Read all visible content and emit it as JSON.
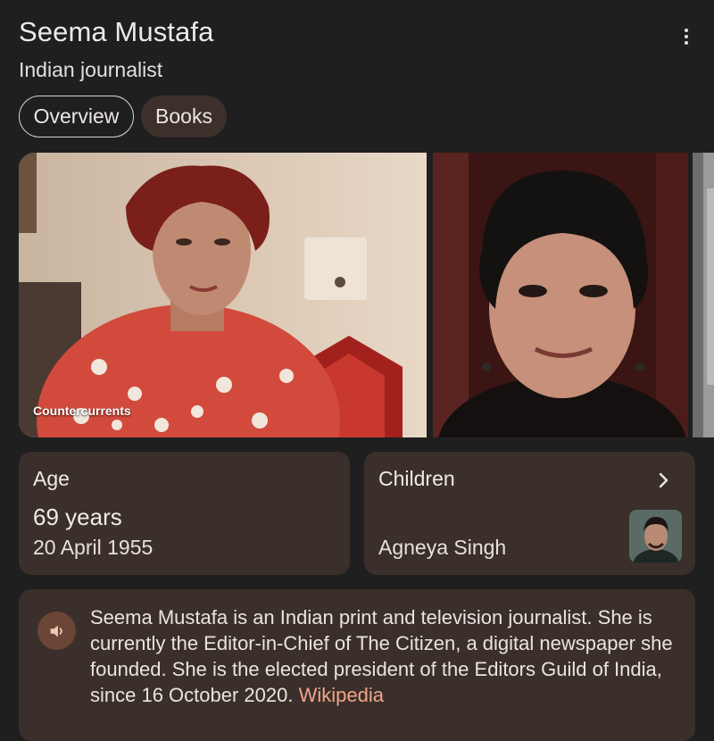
{
  "header": {
    "title": "Seema Mustafa",
    "subtitle": "Indian journalist",
    "menu_icon": "more-vert-icon"
  },
  "tabs": [
    {
      "label": "Overview",
      "selected": true
    },
    {
      "label": "Books",
      "selected": false
    }
  ],
  "images": {
    "first_credit": "Countercurrents"
  },
  "facts": {
    "age": {
      "label": "Age",
      "years": "69 years",
      "birth_date": "20 April 1955"
    },
    "children": {
      "label": "Children",
      "name": "Agneya Singh",
      "icon": "chevron-right-icon"
    }
  },
  "description": {
    "speaker_icon": "volume-icon",
    "text": "Seema Mustafa is an Indian print and television journalist. She is currently the Editor-in-Chief of The Citizen, a digital newspaper she founded. She is the elected president of the Editors Guild of India, since 16 October 2020.",
    "source_link": "Wikipedia"
  },
  "colors": {
    "background": "#1f1f1f",
    "card": "#3a2f2a",
    "link": "#f2a48a",
    "speaker_bg": "#6b4536"
  }
}
